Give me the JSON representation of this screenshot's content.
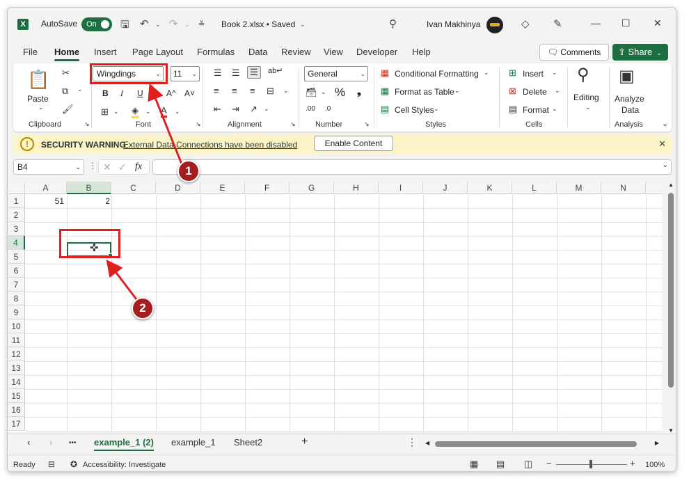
{
  "titlebar": {
    "app_icon": "excel-logo",
    "autosave_label": "AutoSave",
    "autosave_state": "On",
    "doc_title": "Book 2.xlsx • Saved",
    "user_name": "Ivan Makhinya",
    "icons": [
      "save-icon",
      "undo-icon",
      "redo-icon",
      "customize-icon",
      "search-icon",
      "diamond-icon",
      "pen-icon",
      "minimize-icon",
      "maximize-icon",
      "close-icon"
    ]
  },
  "menu": {
    "items": [
      "File",
      "Home",
      "Insert",
      "Page Layout",
      "Formulas",
      "Data",
      "Review",
      "View",
      "Developer",
      "Help"
    ],
    "active": "Home",
    "comments_label": "Comments",
    "share_label": "Share"
  },
  "ribbon": {
    "clipboard": {
      "paste_label": "Paste",
      "group_label": "Clipboard"
    },
    "font": {
      "font_name": "Wingdings",
      "font_size": "11",
      "bold": "B",
      "italic": "I",
      "underline": "U",
      "grow": "A^",
      "shrink": "A˅",
      "group_label": "Font"
    },
    "alignment": {
      "wrap_icon": "ab↵",
      "group_label": "Alignment"
    },
    "number": {
      "format": "General",
      "percent": "%",
      "comma": "❟",
      "inc_dec": ".00",
      "dec_dec": ".0",
      "group_label": "Number"
    },
    "styles": {
      "conditional": "Conditional Formatting",
      "format_table": "Format as Table",
      "cell_styles": "Cell Styles",
      "group_label": "Styles"
    },
    "cells": {
      "insert": "Insert",
      "delete": "Delete",
      "format": "Format",
      "group_label": "Cells"
    },
    "editing": {
      "label": "Editing"
    },
    "analysis": {
      "analyze_label_1": "Analyze",
      "analyze_label_2": "Data",
      "group_label": "Analysis"
    }
  },
  "security": {
    "title": "SECURITY WARNING",
    "message": "External Data Connections have been disabled",
    "button": "Enable Content"
  },
  "formula_bar": {
    "name_box": "B4",
    "fx": "fx",
    "value": ""
  },
  "sheet": {
    "columns": [
      "A",
      "B",
      "C",
      "D",
      "E",
      "F",
      "G",
      "H",
      "I",
      "J",
      "K",
      "L",
      "M",
      "N"
    ],
    "rows": [
      "1",
      "2",
      "3",
      "4",
      "5",
      "6",
      "7",
      "8",
      "9",
      "10",
      "11",
      "12",
      "13",
      "14",
      "15",
      "16",
      "17"
    ],
    "selected_column": "B",
    "selected_row": "4",
    "cells": {
      "A1": "51",
      "B1": "2"
    }
  },
  "tabs": {
    "sheets": [
      "example_1 (2)",
      "example_1",
      "Sheet2"
    ],
    "active": "example_1 (2)",
    "add": "+",
    "more": "•••"
  },
  "status": {
    "ready": "Ready",
    "accessibility": "Accessibility: Investigate",
    "zoom": "100%",
    "zoom_minus": "−",
    "zoom_plus": "+"
  },
  "annotations": {
    "callout_1": "1",
    "callout_2": "2",
    "color": "#e02020"
  }
}
